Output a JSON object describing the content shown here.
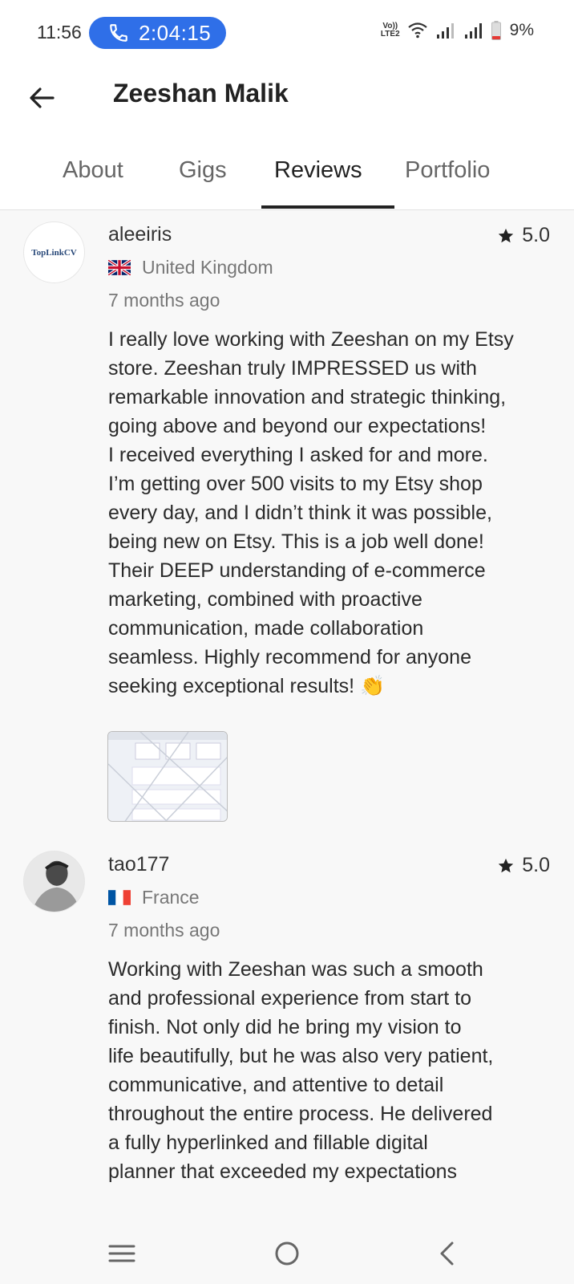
{
  "status": {
    "time": "11:56",
    "call_timer": "2:04:15",
    "volte_top": "Vo))",
    "volte_bottom": "LTE2",
    "battery": "9%"
  },
  "header": {
    "title": "Zeeshan Malik"
  },
  "tabs": [
    {
      "label": "About",
      "active": false
    },
    {
      "label": "Gigs",
      "active": false
    },
    {
      "label": "Reviews",
      "active": true
    },
    {
      "label": "Portfolio",
      "active": false
    }
  ],
  "reviews": [
    {
      "username": "aleeiris",
      "avatar_text": "TopLinkCV",
      "country": "United Kingdom",
      "time_ago": "7 months ago",
      "rating": "5.0",
      "text_lines": [
        "I really love working with Zeeshan on my Etsy",
        "store. Zeeshan truly IMPRESSED us with",
        "remarkable innovation and strategic thinking,",
        "going above and beyond our expectations!",
        "I received everything I asked for and more.",
        "I’m getting over 500 visits to my Etsy shop",
        "every day, and I didn’t think it was possible,",
        "being new on Etsy. This is a job well done!",
        "Their DEEP understanding of e-commerce",
        "marketing, combined with proactive",
        "communication, made collaboration",
        "seamless. Highly recommend for anyone",
        "seeking exceptional results! 👏"
      ]
    },
    {
      "username": "tao177",
      "country": "France",
      "time_ago": "7 months ago",
      "rating": "5.0",
      "text_lines": [
        "Working with Zeeshan was such a smooth",
        "and professional experience from start to",
        "finish. Not only did he bring my vision to",
        "life beautifully, but he was also very patient,",
        "communicative, and attentive to detail",
        "throughout the entire process. He delivered",
        "a fully hyperlinked and fillable digital",
        "planner that exceeded my expectations"
      ]
    }
  ],
  "colors": {
    "call_pill": "#2f6fe8",
    "battery_low": "#e53935"
  }
}
